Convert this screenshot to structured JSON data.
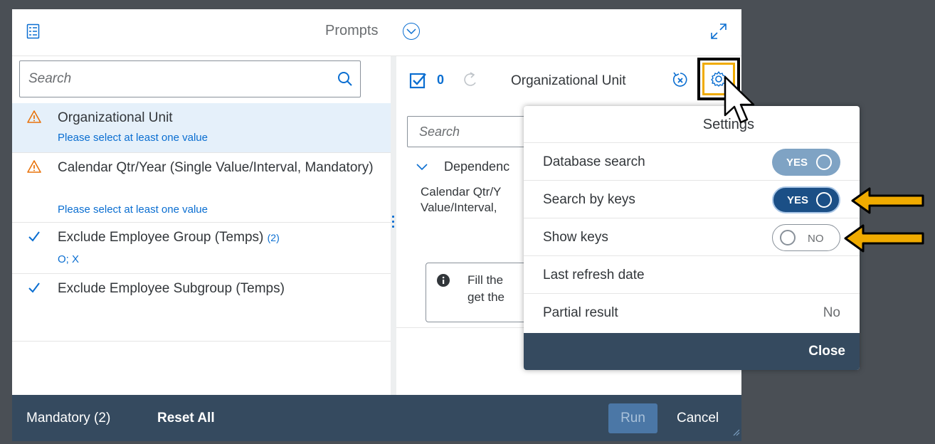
{
  "dialog": {
    "title": "Prompts",
    "left": {
      "search_placeholder": "Search",
      "items": [
        {
          "title": "Organizational Unit",
          "sub": "Please select at least one value",
          "state": "warning"
        },
        {
          "title": "Calendar Qtr/Year (Single Value/Interval, Mandatory)",
          "sub": "Please select at least one value",
          "state": "warning"
        },
        {
          "title": "Exclude Employee Group (Temps)",
          "count": "(2)",
          "sub": "O; X",
          "state": "done"
        },
        {
          "title": "Exclude Employee Subgroup (Temps)",
          "state": "done"
        }
      ]
    },
    "right": {
      "selected_count": "0",
      "title": "Organizational Unit",
      "search_placeholder": "Search",
      "dependency_title": "Dependenc",
      "dependency_text_line1": "Calendar Qtr/Y",
      "dependency_text_line2": "Value/Interval,",
      "info_line1": "Fill the",
      "info_line2": "get the"
    },
    "footer": {
      "mandatory": "Mandatory (2)",
      "reset_all": "Reset All",
      "run": "Run",
      "cancel": "Cancel"
    }
  },
  "settings": {
    "title": "Settings",
    "rows": [
      {
        "label": "Database search",
        "toggle": "YES"
      },
      {
        "label": "Search by keys",
        "toggle": "YES"
      },
      {
        "label": "Show keys",
        "toggle": "NO"
      },
      {
        "label": "Last refresh date"
      },
      {
        "label": "Partial result",
        "value": "No"
      }
    ],
    "close": "Close"
  },
  "colors": {
    "accent": "#0a6ed1",
    "warning": "#e9730c",
    "highlight": "#f0ab00",
    "footer": "#354a5f"
  }
}
